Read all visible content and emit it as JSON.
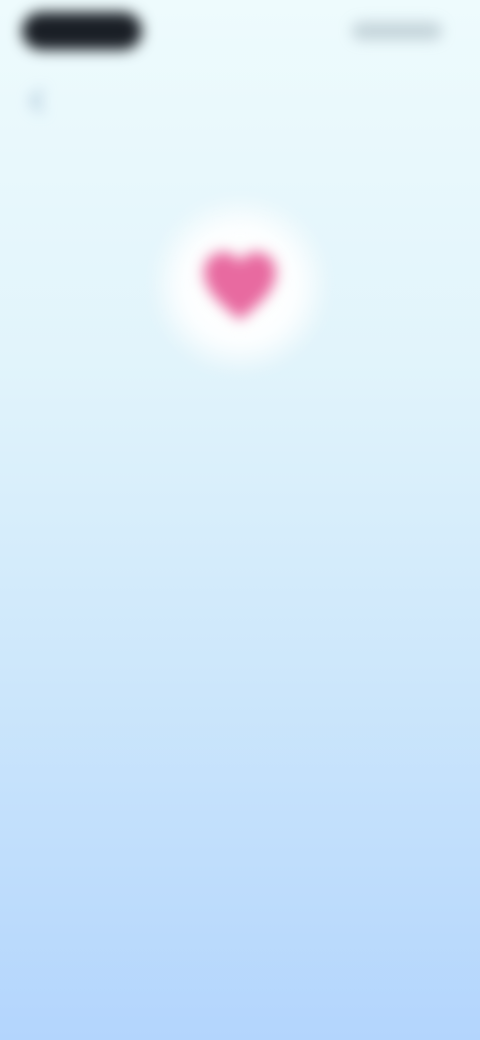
{
  "status_bar": {
    "time": "",
    "indicators": ""
  },
  "nav": {
    "back_icon": "chevron-left-icon"
  },
  "hero": {
    "icon": "heart-icon",
    "icon_color": "#e86aa0",
    "glow_color": "#ffffff"
  },
  "message": {
    "headline": ""
  },
  "colors": {
    "background_top": "#eefbfd",
    "background_bottom": "#b3d5fd",
    "text": "#3a4f68"
  }
}
